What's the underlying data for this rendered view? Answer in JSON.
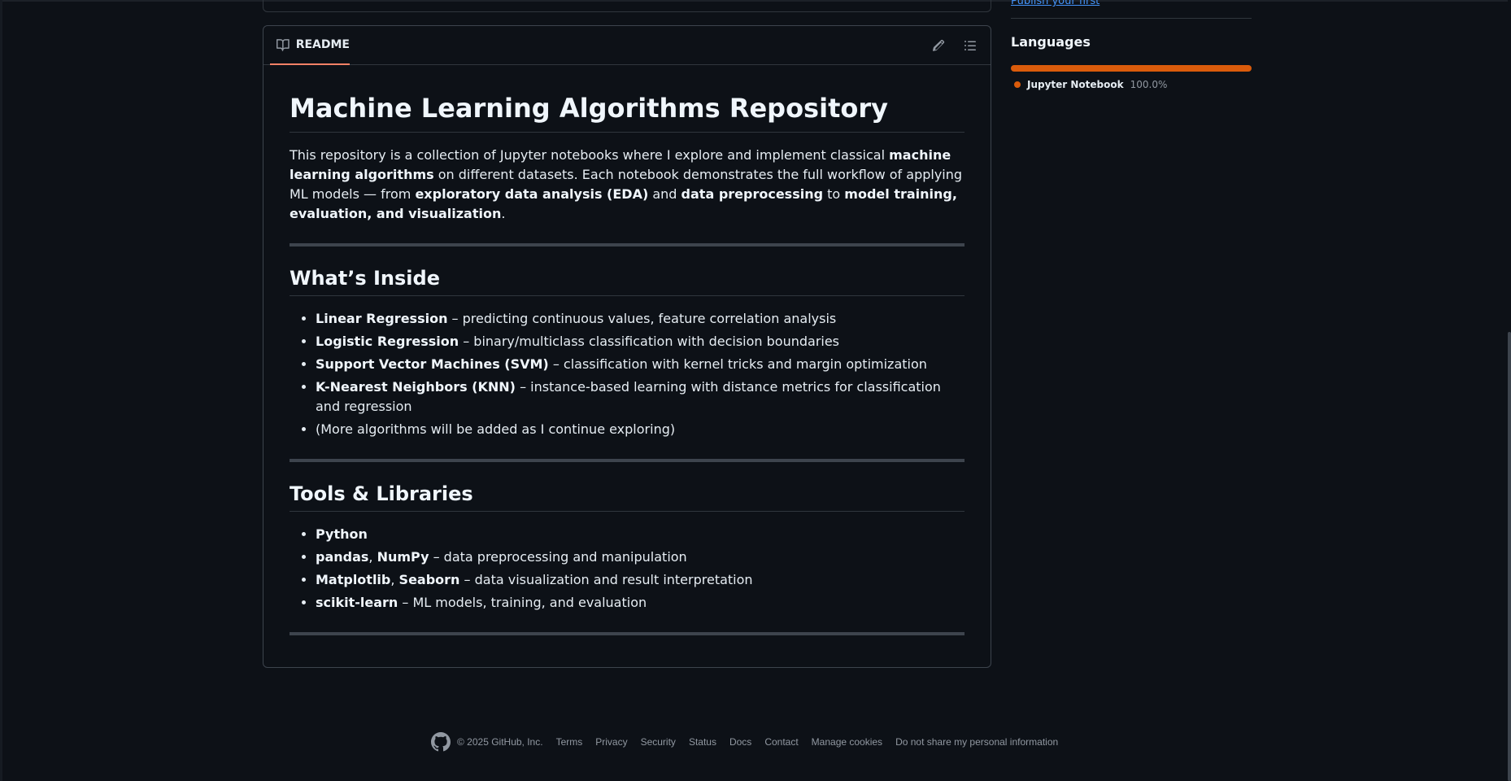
{
  "readme": {
    "tab_label": "README",
    "title": "Machine Learning Algorithms Repository",
    "intro": {
      "t1": "This repository is a collection of Jupyter notebooks where I explore and implement classical ",
      "b1": "machine learning algorithms",
      "t2": " on different datasets. Each notebook demonstrates the full workflow of applying ML models — from ",
      "b2": "exploratory data analysis (EDA)",
      "t3": " and ",
      "b3": "data preprocessing",
      "t4": " to ",
      "b4": "model training, evaluation, and visualization",
      "t5": "."
    },
    "inside": {
      "heading": "What’s Inside",
      "items": [
        {
          "bold": "Linear Regression",
          "text": " – predicting continuous values, feature correlation analysis"
        },
        {
          "bold": "Logistic Regression",
          "text": " – binary/multiclass classification with decision boundaries"
        },
        {
          "bold": "Support Vector Machines (SVM)",
          "text": " – classification with kernel tricks and margin optimization"
        },
        {
          "bold": "K-Nearest Neighbors (KNN)",
          "text": " – instance-based learning with distance metrics for classification and regression"
        },
        {
          "bold": "",
          "text": "(More algorithms will be added as I continue exploring)"
        }
      ]
    },
    "tools": {
      "heading": "Tools & Libraries",
      "items": [
        {
          "b1": "Python",
          "sep": "",
          "b2": "",
          "text": ""
        },
        {
          "b1": "pandas",
          "sep": ", ",
          "b2": "NumPy",
          "text": " – data preprocessing and manipulation"
        },
        {
          "b1": "Matplotlib",
          "sep": ", ",
          "b2": "Seaborn",
          "text": " – data visualization and result interpretation"
        },
        {
          "b1": "scikit-learn",
          "sep": "",
          "b2": "",
          "text": " – ML models, training, and evaluation"
        }
      ]
    }
  },
  "sidebar": {
    "prev_link": "Publish your first package",
    "languages_title": "Languages",
    "languages": [
      {
        "name": "Jupyter Notebook",
        "percent": "100.0%",
        "fraction": 1.0,
        "color": "#da5b0b"
      }
    ]
  },
  "footer": {
    "copyright": "© 2025 GitHub, Inc.",
    "links": [
      "Terms",
      "Privacy",
      "Security",
      "Status",
      "Docs",
      "Contact",
      "Manage cookies",
      "Do not share my personal information"
    ]
  },
  "icons": [
    "book-icon",
    "pencil-icon",
    "list-unordered-icon",
    "github-mark-icon"
  ]
}
